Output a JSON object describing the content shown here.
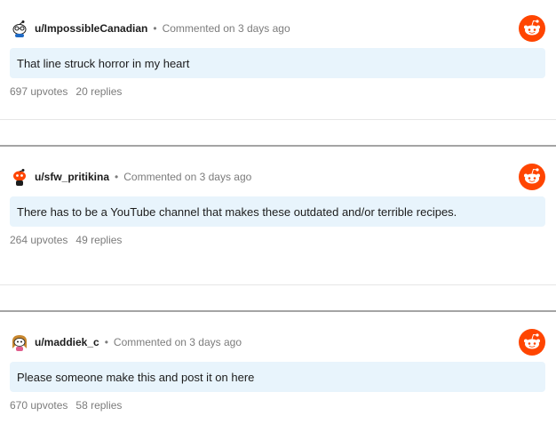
{
  "comments": [
    {
      "author": "u/ImpossibleCanadian",
      "separator": "•",
      "meta": "Commented on 3 days ago",
      "body": "That line struck horror in my heart",
      "upvotes": "697 upvotes",
      "replies": "20 replies",
      "avatar_icon": "snoo-avatar-glasses-icon"
    },
    {
      "author": "u/sfw_pritikina",
      "separator": "•",
      "meta": "Commented on 3 days ago",
      "body": "There has to be a YouTube channel that makes these outdated and/or terrible recipes.",
      "upvotes": "264 upvotes",
      "replies": "49 replies",
      "avatar_icon": "snoo-avatar-red-icon"
    },
    {
      "author": "u/maddiek_c",
      "separator": "•",
      "meta": "Commented on 3 days ago",
      "body": "Please someone make this and post it on here",
      "upvotes": "670 upvotes",
      "replies": "58 replies",
      "avatar_icon": "snoo-avatar-hair-icon"
    }
  ],
  "colors": {
    "reddit_orange": "#ff4500",
    "comment_bg": "#e8f4fc",
    "muted_text": "#7c7c7c"
  }
}
